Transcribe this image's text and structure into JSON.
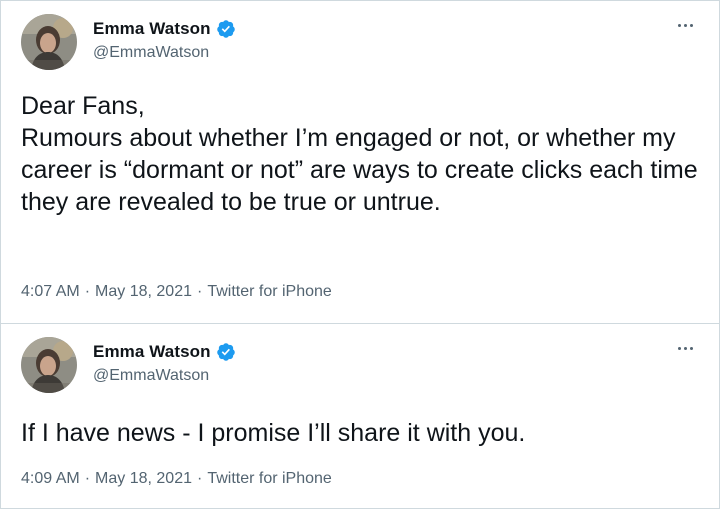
{
  "tweets": [
    {
      "author": {
        "name": "Emma Watson",
        "handle": "@EmmaWatson",
        "avatar_icon": "profile-photo",
        "verified_icon": "verified-badge-icon",
        "verified_color": "#1d9bf0"
      },
      "text": "Dear Fans,\nRumours about whether I’m engaged or not, or whether my career is “dormant or not” are ways to create clicks each time they are revealed to be true or untrue.",
      "time": "4:07 AM",
      "date": "May 18, 2021",
      "source": "Twitter for iPhone",
      "separator": "·"
    },
    {
      "author": {
        "name": "Emma Watson",
        "handle": "@EmmaWatson",
        "avatar_icon": "profile-photo",
        "verified_icon": "verified-badge-icon",
        "verified_color": "#1d9bf0"
      },
      "text": "If I have news - I promise I’ll share it with you.",
      "time": "4:09 AM",
      "date": "May 18, 2021",
      "source": "Twitter for iPhone",
      "separator": "·"
    }
  ],
  "colors": {
    "text_primary": "#0f1419",
    "text_secondary": "#536471",
    "border": "#cfd9de",
    "verified": "#1d9bf0"
  }
}
